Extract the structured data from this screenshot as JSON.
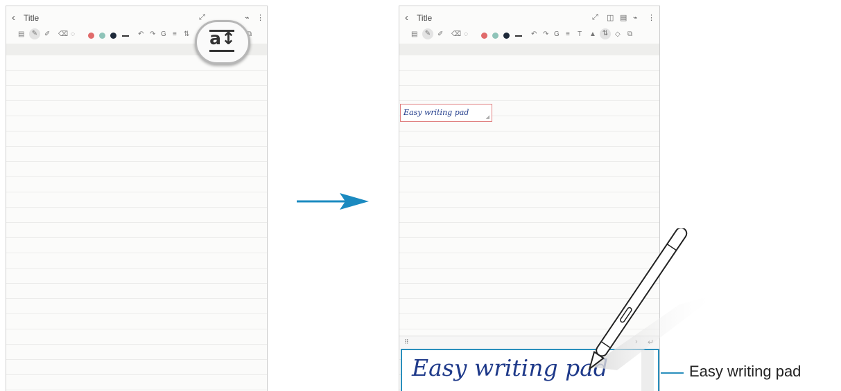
{
  "left_screen": {
    "back_icon": "chevron-left-icon",
    "title": "Title",
    "zoom_icon": "text-spacing-icon"
  },
  "right_screen": {
    "back_icon": "chevron-left-icon",
    "title": "Title",
    "text_box_value": "Easy writing pad"
  },
  "writing_pad": {
    "handwriting": "Easy writing pad"
  },
  "callout": {
    "label": "Easy writing pad",
    "color": "#2a8fbd"
  },
  "colors": {
    "pen_red": "#e06b6b",
    "pen_teal": "#8fc4b9",
    "pen_navy": "#1e2a3a",
    "arrow": "#1b8ac0"
  }
}
